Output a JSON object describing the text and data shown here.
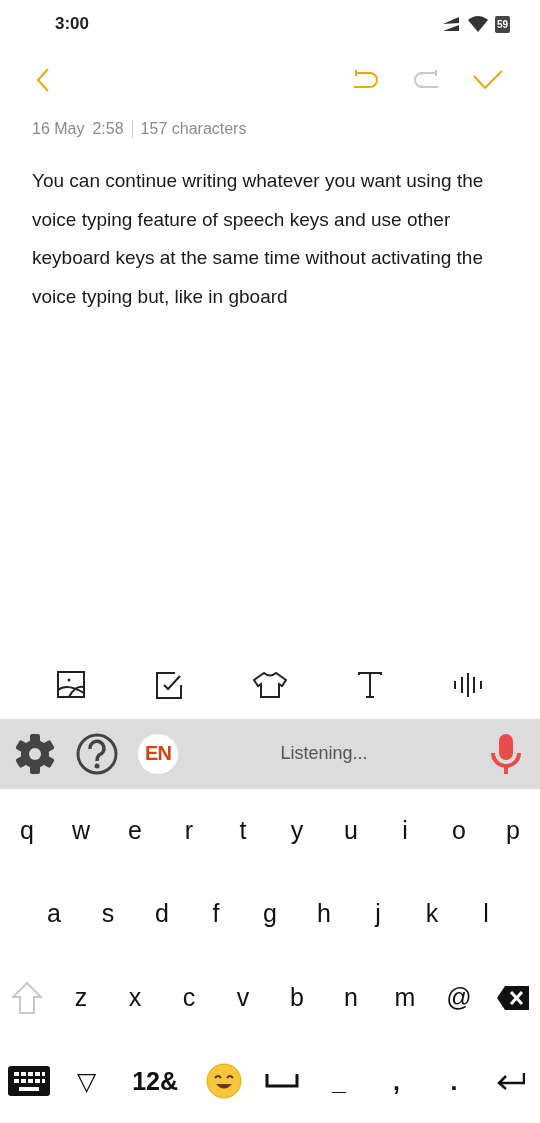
{
  "status_bar": {
    "time": "3:00",
    "battery": "59"
  },
  "toolbar": {
    "undo": {
      "disabled": false
    },
    "redo": {
      "disabled": true
    }
  },
  "meta": {
    "date": "16 May",
    "time": "2:58",
    "count": "157 characters"
  },
  "note": {
    "text": "You can continue writing whatever you want using the voice typing feature of speech keys and use other keyboard keys at the same time without activating the voice typing but, like in gboard"
  },
  "voice_bar": {
    "language": "EN",
    "status": "Listening..."
  },
  "keyboard": {
    "rows": [
      [
        "q",
        "w",
        "e",
        "r",
        "t",
        "y",
        "u",
        "i",
        "o",
        "p"
      ],
      [
        "a",
        "s",
        "d",
        "f",
        "g",
        "h",
        "j",
        "k",
        "l"
      ],
      [
        "z",
        "x",
        "c",
        "v",
        "b",
        "n",
        "m",
        "@"
      ]
    ],
    "shift_disabled": true,
    "bottom": {
      "hide": "▽",
      "symbols": "12&",
      "punctuation": [
        "_",
        ",",
        "."
      ]
    }
  }
}
